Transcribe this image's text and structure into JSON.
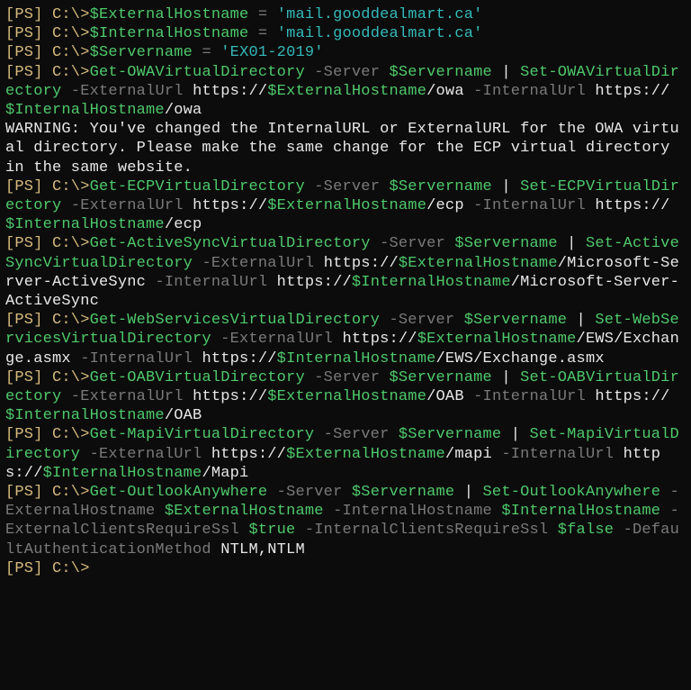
{
  "prompt": "[PS] C:\\>",
  "vars": {
    "externalHostname": {
      "name": "$ExternalHostname",
      "value": "'mail.gooddealmart.ca'"
    },
    "internalHostname": {
      "name": "$InternalHostname",
      "value": "'mail.gooddealmart.ca'"
    },
    "servername": {
      "name": "$Servername",
      "value": "'EX01-2019'"
    }
  },
  "tokens": {
    "eq": " = ",
    "servernameVar": "$Servername",
    "externalVar": "$ExternalHostname",
    "internalVar": "$InternalHostname",
    "trueVal": "$true",
    "falseVal": "$false"
  },
  "params": {
    "server": "-Server",
    "externalUrl": "-ExternalUrl",
    "internalUrl": "-InternalUrl",
    "externalHostname": "-ExternalHostname",
    "internalHostname": "-InternalHostname",
    "externalClientsRequireSsl": "-ExternalClientsRequireSsl",
    "internalClientsRequireSsl": "-InternalClientsRequireSsl",
    "defaultAuthMethod": "-DefaultAuthenticationMethod"
  },
  "cmds": {
    "getOWA": "Get-OWAVirtualDirectory",
    "setOWA": "Set-OWAVirtualDirectory",
    "getECP": "Get-ECPVirtualDirectory",
    "setECP": "Set-ECPVirtualDirectory",
    "getAS": "Get-ActiveSyncVirtualDirectory",
    "setAS": "Set-ActiveSyncVirtualDirectory",
    "getEWS": "Get-WebServicesVirtualDirectory",
    "setEWS": "Set-WebServicesVirtualDirectory",
    "getOAB": "Get-OABVirtualDirectory",
    "setOAB": "Set-OABVirtualDirectory",
    "getMAPI": "Get-MapiVirtualDirectory",
    "setMAPI": "Set-MapiVirtualDirectory",
    "getOA": "Get-OutlookAnywhere",
    "setOA": "Set-OutlookAnywhere"
  },
  "warning": "WARNING: You've changed the InternalURL or ExternalURL for the OWA virtual directory. Please make the same change for the ECP virtual directory in the same website.",
  "paths": {
    "owa": "/owa",
    "ecp": "/ecp",
    "activesync": "/Microsoft-Server-ActiveSync",
    "ews": "/EWS/Exchange.asmx",
    "oab": "/OAB",
    "mapiLower": "/mapi",
    "mapiCap": "/Mapi"
  },
  "https": "https://",
  "pipe": " | ",
  "auth": "NTLM,NTLM"
}
